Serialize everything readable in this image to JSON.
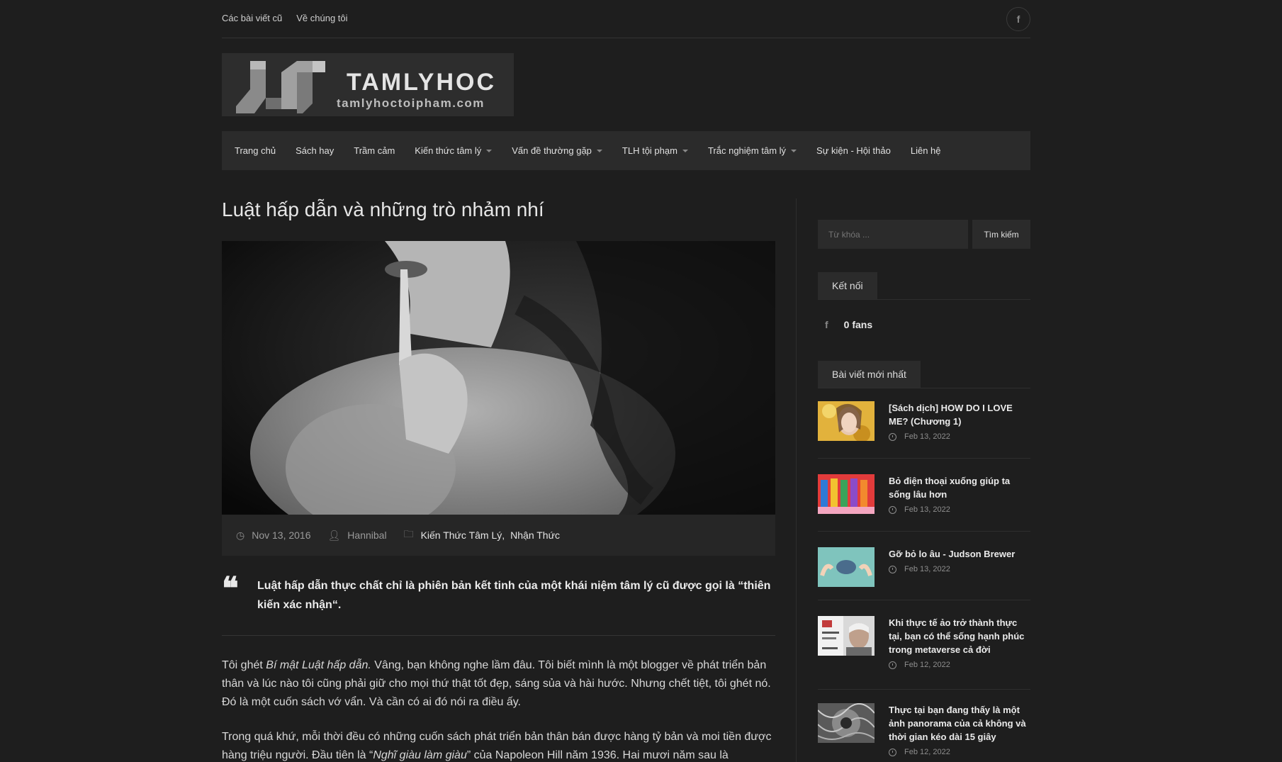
{
  "topbar": {
    "links": [
      "Các bài viết cũ",
      "Về chúng tôi"
    ],
    "social_icon": "facebook-icon"
  },
  "logo": {
    "name": "TAMLYHOC",
    "domain": "tamlyhoctoipham.com"
  },
  "nav": {
    "items": [
      {
        "label": "Trang chủ",
        "has_dropdown": false
      },
      {
        "label": "Sách hay",
        "has_dropdown": false
      },
      {
        "label": "Trầm cảm",
        "has_dropdown": false
      },
      {
        "label": "Kiến thức tâm lý",
        "has_dropdown": true
      },
      {
        "label": "Vấn đề thường gặp",
        "has_dropdown": true
      },
      {
        "label": "TLH tội phạm",
        "has_dropdown": true
      },
      {
        "label": "Trắc nghiệm tâm lý",
        "has_dropdown": true
      },
      {
        "label": "Sự kiện - Hội thảo",
        "has_dropdown": false
      },
      {
        "label": "Liên hệ",
        "has_dropdown": false
      }
    ]
  },
  "post": {
    "title": "Luật hấp dẫn và những trò nhảm nhí",
    "date": "Nov 13, 2016",
    "author": "Hannibal",
    "categories": [
      "Kiến Thức Tâm Lý",
      "Nhận Thức"
    ],
    "category_separator": ",",
    "quote": "Luật hấp dẫn thực chất chỉ là phiên bản kết tinh của một khái niệm tâm lý cũ được gọi là “thiên kiến xác nhận“.",
    "p1_a": "Tôi ghét ",
    "p1_em": "Bí mật Luật hấp dẫn.",
    "p1_b": " Vâng, bạn không nghe lầm đâu. Tôi biết mình là một blogger về phát triển bản thân và lúc nào tôi cũng phải giữ cho mọi thứ thật tốt đẹp, sáng sủa và hài hước. Nhưng chết tiệt, tôi ghét nó. Đó là một cuốn sách vớ vẩn. Và cần có ai đó nói ra điều ấy.",
    "p2_a": "Trong quá khứ, mỗi thời đều có những cuốn sách phát triển bản thân bán được hàng tỷ bản và moi tiền được hàng triệu người. Đầu tiên là “",
    "p2_em": "Nghĩ giàu làm giàu",
    "p2_b": "” của Napoleon Hill năm 1936. Hai mươi năm sau là"
  },
  "sidebar": {
    "search_placeholder": "Từ khóa ...",
    "search_button": "Tìm kiếm",
    "connect_title": "Kết nối",
    "fans": "0 fans",
    "latest_title": "Bài viết mới nhất",
    "latest": [
      {
        "title": "[Sách dịch] HOW DO I LOVE ME? (Chương 1)",
        "date": "Feb 13, 2022"
      },
      {
        "title": "Bỏ điện thoại xuống giúp ta sống lâu hơn",
        "date": "Feb 13, 2022"
      },
      {
        "title": "Gỡ bỏ lo âu - Judson Brewer",
        "date": "Feb 13, 2022"
      },
      {
        "title": "Khi thực tế ảo trở thành thực tại, bạn có thể sống hạnh phúc trong metaverse cả đời",
        "date": "Feb 12, 2022"
      },
      {
        "title": "Thực tại bạn đang thấy là một ảnh panorama của cả không và thời gian kéo dài 15 giây",
        "date": "Feb 12, 2022"
      }
    ]
  }
}
